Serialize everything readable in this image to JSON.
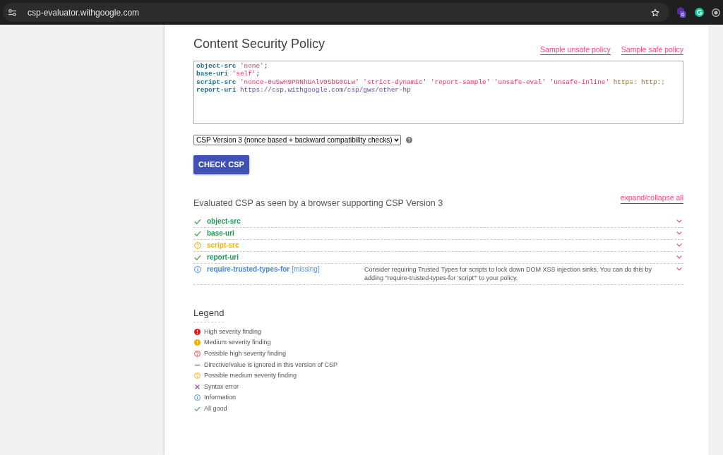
{
  "browser": {
    "url": "csp-evaluator.withgoogle.com",
    "extension_badge": "6"
  },
  "policy_section": {
    "title": "Content Security Policy",
    "links": [
      "Sample unsafe policy",
      "Sample safe policy"
    ],
    "policy_lines": [
      {
        "tokens": [
          {
            "kind": "directive",
            "text": "object-src"
          },
          {
            "kind": "keyword",
            "text": " 'none'"
          },
          {
            "kind": "plain",
            "text": ";"
          }
        ]
      },
      {
        "tokens": [
          {
            "kind": "directive",
            "text": "base-uri"
          },
          {
            "kind": "keyword",
            "text": " 'self'"
          },
          {
            "kind": "plain",
            "text": ";"
          }
        ]
      },
      {
        "tokens": [
          {
            "kind": "directive",
            "text": "script-src"
          },
          {
            "kind": "keyword",
            "text": " 'nonce-0u5wH9PRNhUAlV05bG0GLw' 'strict-dynamic' 'report-sample' 'unsafe-eval' 'unsafe-inline'"
          },
          {
            "kind": "scheme",
            "text": " https: http:;"
          }
        ]
      },
      {
        "tokens": [
          {
            "kind": "directive",
            "text": "report-uri"
          },
          {
            "kind": "url",
            "text": " https://csp.withgoogle.com/csp/gws/other-hp"
          }
        ]
      }
    ]
  },
  "version_select": {
    "value": "CSP Version 3 (nonce based + backward compatibility checks)"
  },
  "check_button": "CHECK CSP",
  "evaluation": {
    "title": "Evaluated CSP as seen by a browser supporting CSP Version 3",
    "toggle_all": "expand/collapse all",
    "rows": [
      {
        "kind": "ok",
        "directive": "object-src"
      },
      {
        "kind": "ok",
        "directive": "base-uri"
      },
      {
        "kind": "possible_medium",
        "directive": "script-src"
      },
      {
        "kind": "ok",
        "directive": "report-uri"
      },
      {
        "kind": "info",
        "directive": "require-trusted-types-for",
        "note": "[missing]",
        "description": "Consider requiring Trusted Types for scripts to lock down DOM XSS injection sinks. You can do this by adding \"require-trusted-types-for 'script'\" to your policy."
      }
    ]
  },
  "legend": {
    "title": "Legend",
    "items": [
      {
        "kind": "high",
        "label": "High severity finding"
      },
      {
        "kind": "medium",
        "label": "Medium severity finding"
      },
      {
        "kind": "possible_high",
        "label": "Possible high severity finding"
      },
      {
        "kind": "ignored",
        "label": "Directive/value is ignored in this version of CSP"
      },
      {
        "kind": "possible_medium",
        "label": "Possible medium severity finding"
      },
      {
        "kind": "syntax_error",
        "label": "Syntax error"
      },
      {
        "kind": "info",
        "label": "Information"
      },
      {
        "kind": "ok",
        "label": "All good"
      }
    ]
  }
}
